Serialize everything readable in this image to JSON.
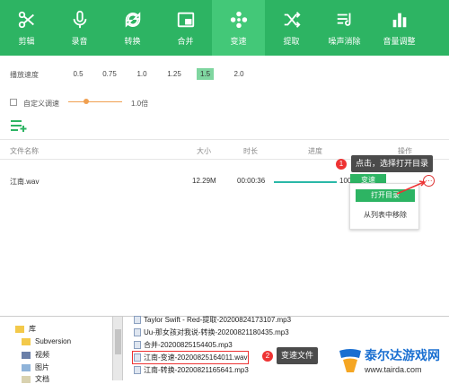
{
  "toolbar": {
    "items": [
      {
        "label": "剪辑",
        "icon": "scissors-icon"
      },
      {
        "label": "录音",
        "icon": "microphone-icon"
      },
      {
        "label": "转换",
        "icon": "refresh-icon"
      },
      {
        "label": "合并",
        "icon": "merge-icon"
      },
      {
        "label": "变速",
        "icon": "speed-icon",
        "active": true
      },
      {
        "label": "提取",
        "icon": "shuffle-icon"
      },
      {
        "label": "噪声消除",
        "icon": "noise-icon"
      },
      {
        "label": "音量调整",
        "icon": "volume-bars-icon"
      }
    ]
  },
  "speed": {
    "label": "播放速度",
    "options": [
      "0.5",
      "0.75",
      "1.0",
      "1.25",
      "1.5",
      "2.0"
    ],
    "selected": "1.5"
  },
  "custom": {
    "label": "自定义调速",
    "value": "1.0倍"
  },
  "table": {
    "headers": [
      "文件名称",
      "大小",
      "时长",
      "进度",
      "操作"
    ],
    "row": {
      "name": "江南.wav",
      "size": "12.29M",
      "duration": "00:00:36",
      "progress_text": "100%",
      "action_label": "变速"
    }
  },
  "menu": {
    "open_dir": "打开目录",
    "remove": "从列表中移除"
  },
  "callouts": {
    "one": {
      "badge": "1",
      "text": "点击，选择打开目录"
    },
    "two": {
      "badge": "2",
      "text": "变速文件"
    }
  },
  "explorer": {
    "nav": [
      "库",
      "Subversion",
      "视频",
      "图片",
      "文档"
    ],
    "files": [
      "Taylor Swift - Red-提取-20200824173107.mp3",
      "Uu-那女孩对我说-转换-20200821180435.mp3",
      "合并-20200825154405.mp3",
      "江南-变速-20200825164011.wav",
      "江南-转换-20200821165641.mp3"
    ]
  },
  "watermark": {
    "title": "泰尔达游戏网",
    "url": "www.tairda.com"
  },
  "colors": {
    "accent": "#2db463",
    "highlight": "#e33333"
  }
}
